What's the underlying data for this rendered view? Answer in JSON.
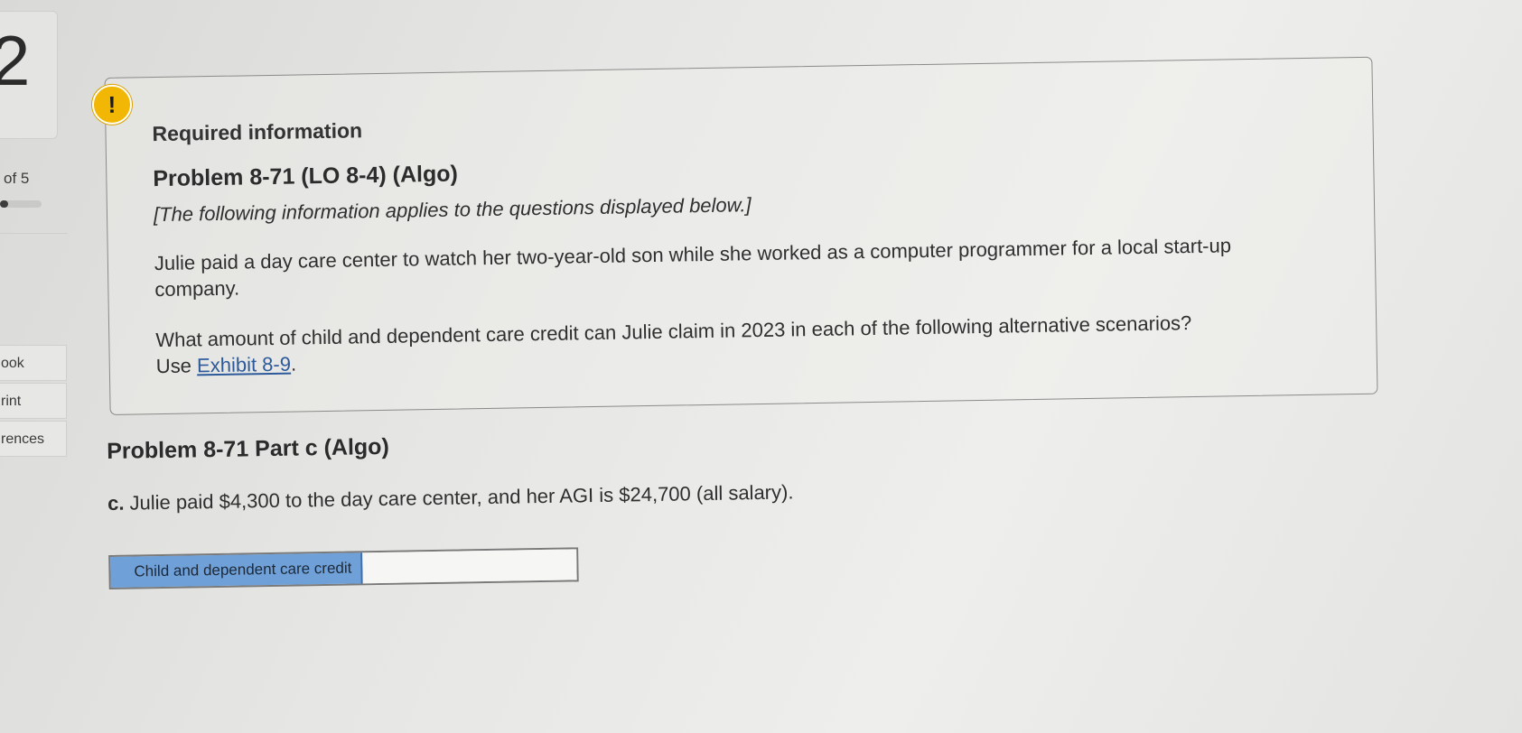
{
  "sidebar": {
    "question_number": "2",
    "question_of": "of 5",
    "progress_fraction": 0.2,
    "buttons": [
      {
        "label": "ook"
      },
      {
        "label": "rint"
      },
      {
        "label": "rences"
      }
    ]
  },
  "info_card": {
    "alert_symbol": "!",
    "required_title": "Required information",
    "problem_title": "Problem 8-71 (LO 8-4) (Algo)",
    "note": "[The following information applies to the questions displayed below.]",
    "scenario_text": "Julie paid a day care center to watch her two-year-old son while she worked as a computer programmer for a local start-up company.",
    "question_text": "What amount of child and dependent care credit can Julie claim in 2023 in each of the following alternative scenarios?",
    "use_prefix": "Use ",
    "exhibit_link": "Exhibit 8-9",
    "use_suffix": "."
  },
  "part_c": {
    "title": "Problem 8-71 Part c (Algo)",
    "label": "c.",
    "question": "Julie paid $4,300 to the day care center, and her AGI is $24,700 (all salary).",
    "answer_label": "Child and dependent care credit",
    "answer_value": ""
  },
  "colors": {
    "alert_badge": "#f2b705",
    "answer_label_bg": "#6fa0d8",
    "link": "#2c5a9a"
  }
}
